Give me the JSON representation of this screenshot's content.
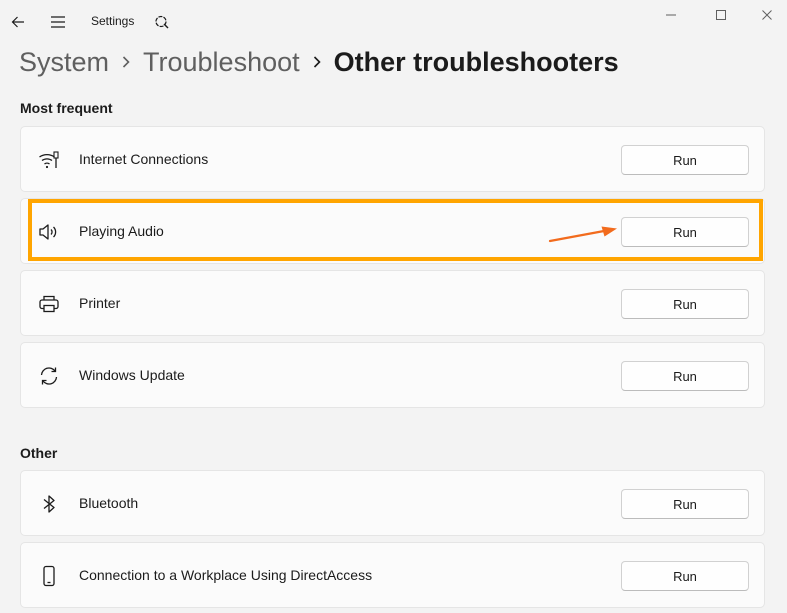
{
  "window": {
    "app_title": "Settings",
    "controls": [
      "minimize",
      "maximize",
      "close"
    ]
  },
  "breadcrumb": {
    "items": [
      "System",
      "Troubleshoot",
      "Other troubleshooters"
    ]
  },
  "sections": [
    {
      "heading": "Most frequent",
      "items": [
        {
          "label": "Internet Connections",
          "icon": "wifi-icon",
          "button": "Run"
        },
        {
          "label": "Playing Audio",
          "icon": "speaker-icon",
          "button": "Run",
          "highlighted": true
        },
        {
          "label": "Printer",
          "icon": "printer-icon",
          "button": "Run"
        },
        {
          "label": "Windows Update",
          "icon": "sync-icon",
          "button": "Run"
        }
      ]
    },
    {
      "heading": "Other",
      "items": [
        {
          "label": "Bluetooth",
          "icon": "bluetooth-icon",
          "button": "Run"
        },
        {
          "label": "Connection to a Workplace Using DirectAccess",
          "icon": "phone-icon",
          "button": "Run"
        }
      ]
    }
  ],
  "colors": {
    "highlight": "#ffa500",
    "arrow": "#f26b1d",
    "background": "#f3f3f3",
    "card": "#fbfbfb"
  }
}
